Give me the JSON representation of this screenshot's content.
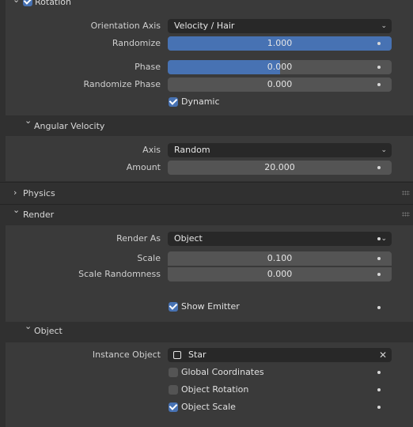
{
  "rotation": {
    "title": "Rotation",
    "enabled": true,
    "orientation_axis": {
      "label": "Orientation Axis",
      "value": "Velocity / Hair"
    },
    "randomize": {
      "label": "Randomize",
      "value": "1.000",
      "fill": 1.0
    },
    "phase": {
      "label": "Phase",
      "value": "0.000",
      "fill": 0.5
    },
    "randomize_phase": {
      "label": "Randomize Phase",
      "value": "0.000"
    },
    "dynamic": {
      "label": "Dynamic",
      "checked": true
    }
  },
  "angular_velocity": {
    "title": "Angular Velocity",
    "axis": {
      "label": "Axis",
      "value": "Random"
    },
    "amount": {
      "label": "Amount",
      "value": "20.000"
    }
  },
  "physics": {
    "title": "Physics"
  },
  "render": {
    "title": "Render",
    "render_as": {
      "label": "Render As",
      "value": "Object"
    },
    "scale": {
      "label": "Scale",
      "value": "0.100"
    },
    "scale_randomness": {
      "label": "Scale Randomness",
      "value": "0.000"
    },
    "show_emitter": {
      "label": "Show Emitter",
      "checked": true
    }
  },
  "object": {
    "title": "Object",
    "instance_object": {
      "label": "Instance Object",
      "value": "Star"
    },
    "global_coordinates": {
      "label": "Global Coordinates",
      "checked": false
    },
    "object_rotation": {
      "label": "Object Rotation",
      "checked": false
    },
    "object_scale": {
      "label": "Object Scale",
      "checked": true
    }
  },
  "icons": {
    "collapse": "chevron-down-icon",
    "expand": "chevron-right-icon",
    "dropdown": "chevron-down-icon",
    "clear": "close-icon",
    "object": "object-icon",
    "animate": "keyframe-dot-icon"
  },
  "colors": {
    "accent": "#4772b3",
    "panel": "#3a3a3a",
    "header": "#303030",
    "field": "#545454",
    "dropdown": "#282828"
  }
}
